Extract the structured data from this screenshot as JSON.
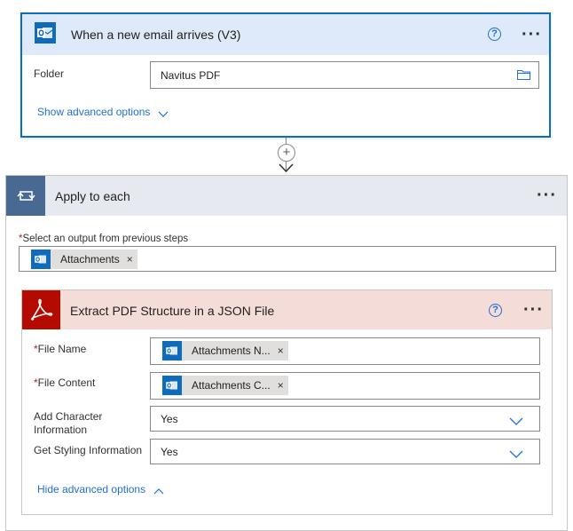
{
  "trigger": {
    "title": "When a new email arrives (V3)",
    "folder_label": "Folder",
    "folder_value": "Navitus PDF",
    "advanced_link": "Show advanced options"
  },
  "connector": {
    "add_symbol": "+"
  },
  "apply": {
    "title": "Apply to each",
    "select_label": "Select an output from previous steps",
    "required_mark": "*",
    "token_label": "Attachments",
    "token_remove": "×"
  },
  "pdf": {
    "title": "Extract PDF Structure in a JSON File",
    "fields": {
      "file_name_label": "File Name",
      "file_name_token": "Attachments N...",
      "file_content_label": "File Content",
      "file_content_token": "Attachments C...",
      "char_info_label_1": "Add Character",
      "char_info_label_2": "Information",
      "char_info_value": "Yes",
      "styling_label": "Get Styling Information",
      "styling_value": "Yes"
    },
    "advanced_link": "Hide advanced options"
  },
  "help_symbol": "?",
  "more_symbol": "···",
  "colors": {
    "outlook_blue": "#0f6cbd",
    "trigger_header": "#deeaf9",
    "apply_header": "#e6e9ef",
    "loop_tile": "#486991",
    "pdf_header": "#f4dcd9",
    "pdf_tile": "#b30b00",
    "link_blue": "#1e6fd6",
    "required_red": "#a4262c"
  },
  "icons": [
    "outlook-icon",
    "folder-icon",
    "chevron-down-icon",
    "loop-icon",
    "acrobat-icon",
    "help-icon",
    "more-icon",
    "chevron-up-icon"
  ]
}
